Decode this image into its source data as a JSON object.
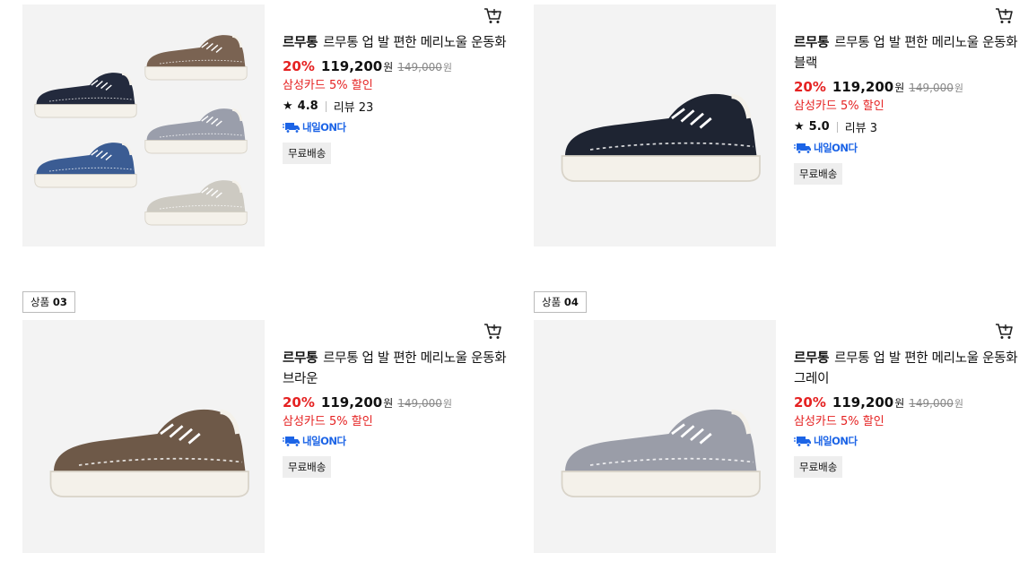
{
  "colors": {
    "accent_red": "#e52222",
    "delivery_blue": "#1c64e6",
    "image_bg": "#f3f3f3"
  },
  "products": [
    {
      "label_prefix": "",
      "label_number": "",
      "brand": "르무통",
      "name": "르무통 업 발 편한 메리노울 운동화",
      "discount": "20%",
      "price": "119,200",
      "price_unit": "원",
      "original_price": "149,000",
      "original_unit": "원",
      "card_promo": "삼성카드 5% 할인",
      "rating": "4.8",
      "review_label": "리뷰 23",
      "delivery_badge": "내일ON다",
      "shipping": "무료배송",
      "cart_icon": "cart-icon"
    },
    {
      "label_prefix": "",
      "label_number": "",
      "brand": "르무통",
      "name": "르무통 업 발 편한 메리노울 운동화 블랙",
      "discount": "20%",
      "price": "119,200",
      "price_unit": "원",
      "original_price": "149,000",
      "original_unit": "원",
      "card_promo": "삼성카드 5% 할인",
      "rating": "5.0",
      "review_label": "리뷰 3",
      "delivery_badge": "내일ON다",
      "shipping": "무료배송",
      "cart_icon": "cart-icon"
    },
    {
      "label_prefix": "상품",
      "label_number": "03",
      "brand": "르무통",
      "name": "르무통 업 발 편한 메리노울 운동화 브라운",
      "discount": "20%",
      "price": "119,200",
      "price_unit": "원",
      "original_price": "149,000",
      "original_unit": "원",
      "card_promo": "삼성카드 5% 할인",
      "delivery_badge": "내일ON다",
      "shipping": "무료배송",
      "cart_icon": "cart-icon"
    },
    {
      "label_prefix": "상품",
      "label_number": "04",
      "brand": "르무통",
      "name": "르무통 업 발 편한 메리노울 운동화 그레이",
      "discount": "20%",
      "price": "119,200",
      "price_unit": "원",
      "original_price": "149,000",
      "original_unit": "원",
      "card_promo": "삼성카드 5% 할인",
      "delivery_badge": "내일ON다",
      "shipping": "무료배송",
      "cart_icon": "cart-icon"
    }
  ]
}
